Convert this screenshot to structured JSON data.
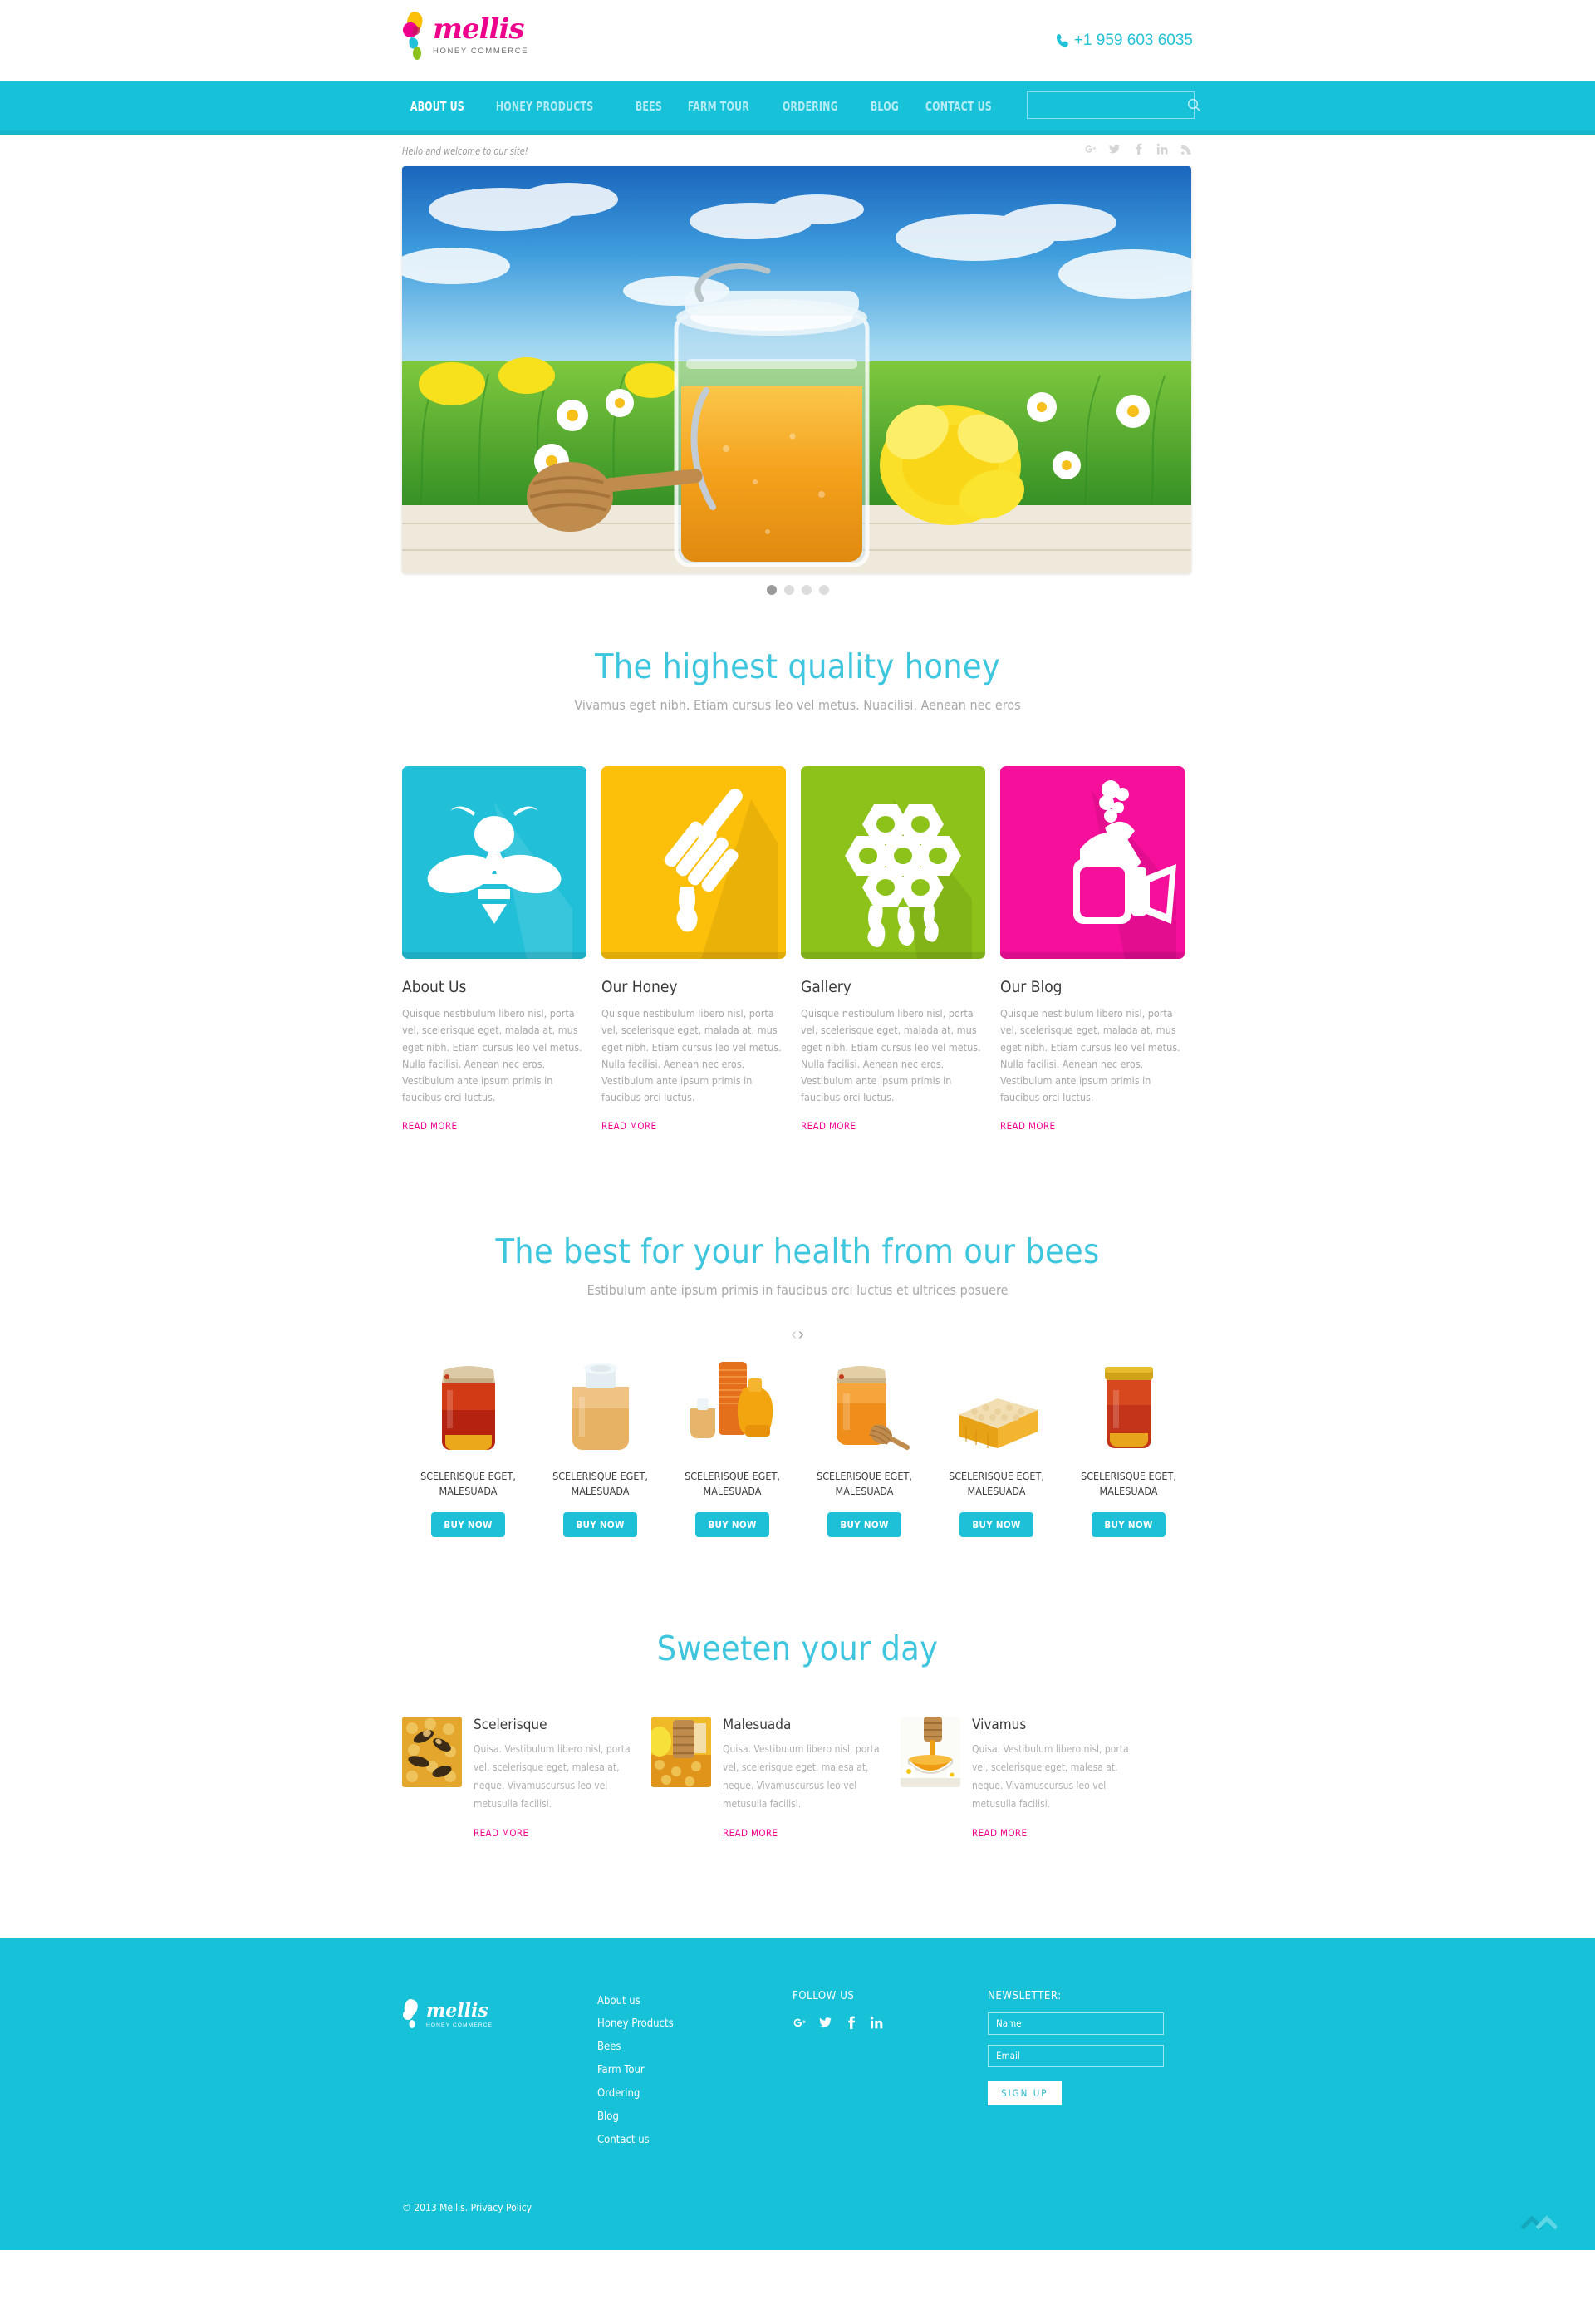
{
  "header": {
    "logo_word": "mellis",
    "logo_sub": "HONEY COMMERCE",
    "phone": "+1 959 603 6035",
    "phone_icon": "phone-icon"
  },
  "nav": {
    "items": [
      {
        "label": "ABOUT US",
        "active": true
      },
      {
        "label": "HONEY PRODUCTS",
        "active": false
      },
      {
        "label": "BEES",
        "active": false
      },
      {
        "label": "FARM TOUR",
        "active": false
      },
      {
        "label": "ORDERING",
        "active": false
      },
      {
        "label": "BLOG",
        "active": false
      },
      {
        "label": "CONTACT US",
        "active": false
      }
    ],
    "search_placeholder": "",
    "search_value": "",
    "search_icon": "search-icon"
  },
  "tagline": {
    "text": "Hello and welcome to our site!",
    "social": [
      {
        "name": "google-plus-icon",
        "glyph": "g⁺"
      },
      {
        "name": "twitter-icon",
        "glyph": "ᵗ"
      },
      {
        "name": "facebook-icon",
        "glyph": "f"
      },
      {
        "name": "linkedin-icon",
        "glyph": "in"
      },
      {
        "name": "rss-icon",
        "glyph": "◔"
      }
    ]
  },
  "slider": {
    "slide_alt": "Honey jar in a flower meadow under blue sky",
    "dots": 4,
    "active_dot": 0
  },
  "section_highest": {
    "title": "The highest quality honey",
    "subtitle": "Vivamus eget nibh. Etiam cursus leo vel metus. Nuacilisi. Aenean nec eros"
  },
  "features": [
    {
      "icon": "bee-icon",
      "color": "#22c0d8",
      "shadow": "#1bb1c8",
      "title": "About Us",
      "text": "Quisque nestibulum libero nisl, porta vel, scelerisque eget, malada at, mus eget nibh. Etiam cursus leo vel metus. Nulla facilisi. Aenean nec eros. Vestibulum ante ipsum primis in faucibus orci luctus.",
      "read_more": "READ MORE"
    },
    {
      "icon": "honey-dipper-icon",
      "color": "#fcc00a",
      "shadow": "#e9ae04",
      "title": "Our Honey",
      "text": "Quisque nestibulum libero nisl, porta vel, scelerisque eget, malada at, mus eget nibh. Etiam cursus leo vel metus. Nulla facilisi. Aenean nec eros. Vestibulum ante ipsum primis in faucibus orci luctus.",
      "read_more": "READ MORE"
    },
    {
      "icon": "honeycomb-icon",
      "color": "#8cc21a",
      "shadow": "#7cae13",
      "title": "Gallery",
      "text": "Quisque nestibulum libero nisl, porta vel, scelerisque eget, malada at, mus eget nibh. Etiam cursus leo vel metus. Nulla facilisi. Aenean nec eros. Vestibulum ante ipsum primis in faucibus orci luctus.",
      "read_more": "READ MORE"
    },
    {
      "icon": "bee-smoker-icon",
      "color": "#f50f9b",
      "shadow": "#dd0a8b",
      "title": "Our Blog",
      "text": "Quisque nestibulum libero nisl, porta vel, scelerisque eget, malada at, mus eget nibh. Etiam cursus leo vel metus. Nulla facilisi. Aenean nec eros. Vestibulum ante ipsum primis in faucibus orci luctus.",
      "read_more": "READ MORE"
    }
  ],
  "section_best": {
    "title": "The best for your health from our bees",
    "subtitle": "Estibulum ante ipsum primis in faucibus orci luctus et ultrices posuere",
    "prev_arrow": "‹",
    "next_arrow": "›"
  },
  "products": [
    {
      "image": "dark-red-honey-jar",
      "name": "SCELERISQUE EGET, MALESUADA",
      "buy_label": "BUY NOW"
    },
    {
      "image": "creamed-honey-jar",
      "name": "SCELERISQUE EGET, MALESUADA",
      "buy_label": "BUY NOW"
    },
    {
      "image": "honey-jars-group",
      "name": "SCELERISQUE EGET, MALESUADA",
      "buy_label": "BUY NOW"
    },
    {
      "image": "honey-jar-with-dipper",
      "name": "SCELERISQUE EGET, MALESUADA",
      "buy_label": "BUY NOW"
    },
    {
      "image": "honeycomb-block",
      "name": "SCELERISQUE EGET, MALESUADA",
      "buy_label": "BUY NOW"
    },
    {
      "image": "amber-honey-jar",
      "name": "SCELERISQUE EGET, MALESUADA",
      "buy_label": "BUY NOW"
    }
  ],
  "section_sweeten": {
    "title": "Sweeten your day"
  },
  "posts": [
    {
      "thumb": "bees-on-comb-photo",
      "title": "Scelerisque",
      "text": "Quisa. Vestibulum libero nisl, porta vel, scelerisque eget, malesa at, neque. Vivamuscursus leo vel metusulla facilisi.",
      "read_more": "READ MORE"
    },
    {
      "thumb": "dipper-on-comb-photo",
      "title": "Malesuada",
      "text": "Quisa. Vestibulum libero nisl, porta vel, scelerisque eget, malesa at, neque. Vivamuscursus leo vel metusulla facilisi.",
      "read_more": "READ MORE"
    },
    {
      "thumb": "honey-pouring-bowl-photo",
      "title": "Vivamus",
      "text": "Quisa. Vestibulum libero nisl, porta vel, scelerisque eget, malesa at, neque. Vivamuscursus leo vel metusulla facilisi.",
      "read_more": "READ MORE"
    }
  ],
  "footer": {
    "logo_word": "mellis",
    "logo_sub": "HONEY COMMERCE",
    "nav": [
      "About us",
      "Honey Products",
      "Bees",
      "Farm Tour",
      "Ordering",
      "Blog",
      "Contact us"
    ],
    "follow_heading": "FOLLOW US",
    "social": [
      {
        "name": "google-plus-icon",
        "glyph": "g⁺"
      },
      {
        "name": "twitter-icon",
        "glyph": "ᵗ"
      },
      {
        "name": "facebook-icon",
        "glyph": "f"
      },
      {
        "name": "linkedin-icon",
        "glyph": "in"
      }
    ],
    "newsletter_heading": "NEWSLETTER:",
    "name_placeholder": "Name",
    "name_value": "",
    "email_placeholder": "Email",
    "email_value": "",
    "signup_label": "SIGN UP",
    "copyright": "© 2013 Mellis. Privacy Policy",
    "to_top_icon": "chevron-up-icon"
  },
  "colors": {
    "brand_cyan": "#17c1d8",
    "brand_pink": "#ec008c",
    "heading_cyan": "#3ec6de",
    "body_gray": "#a8a8a8"
  }
}
